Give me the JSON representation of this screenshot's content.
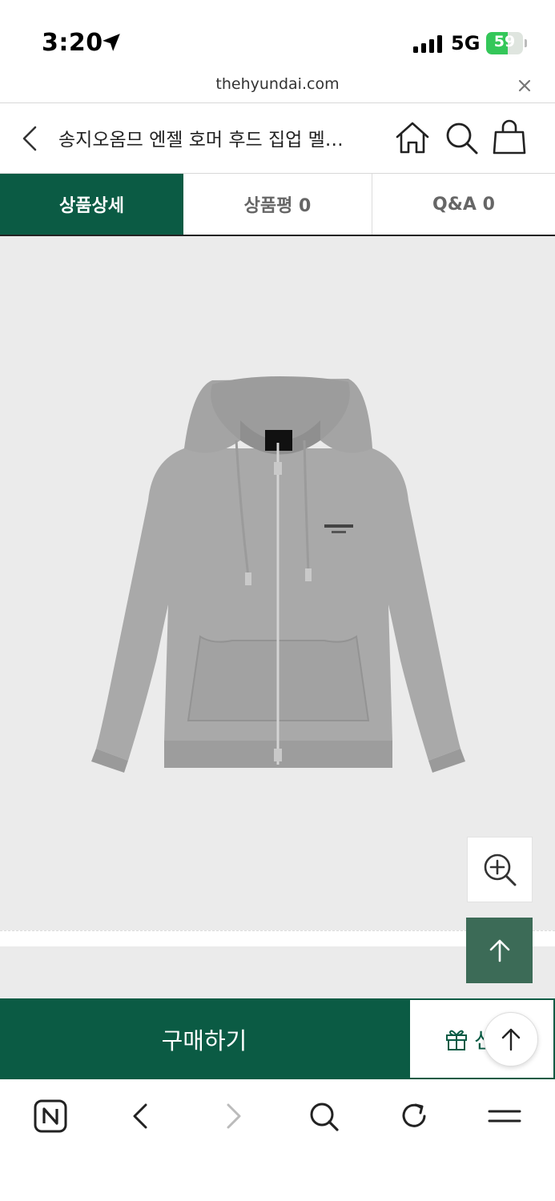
{
  "status_bar": {
    "time": "3:20",
    "network": "5G",
    "battery_percent": "59",
    "battery_level": 0.59,
    "icons": [
      "location-arrow-icon",
      "signal-bars-icon",
      "battery-charging-icon"
    ]
  },
  "url_bar": {
    "domain": "thehyundai.com",
    "close_icon": "close-icon"
  },
  "header": {
    "title": "송지오옴므 엔젤 호머 후드 집업 멜…",
    "icons": [
      "back-icon",
      "home-icon",
      "search-icon",
      "shopping-bag-icon"
    ]
  },
  "tabs": [
    {
      "label": "상품상세",
      "active": true
    },
    {
      "label": "상품평 0",
      "active": false
    },
    {
      "label": "Q&A 0",
      "active": false
    }
  ],
  "product": {
    "image_icon": "gray-zip-hoodie-image",
    "zoom_icon": "zoom-in-icon",
    "top_icon": "arrow-up-icon"
  },
  "actions": {
    "buy_label": "구매하기",
    "gift_label": "선물",
    "gift_icon": "gift-icon"
  },
  "browser_toolbar": {
    "icons": [
      "naver-n-icon",
      "back-arrow-icon",
      "forward-arrow-icon",
      "search-icon",
      "reload-icon",
      "menu-icon"
    ]
  },
  "colors": {
    "brand_green": "#0b5b44",
    "top_button": "#3c6b57",
    "product_bg": "#ebebeb",
    "battery_green": "#34c759"
  }
}
